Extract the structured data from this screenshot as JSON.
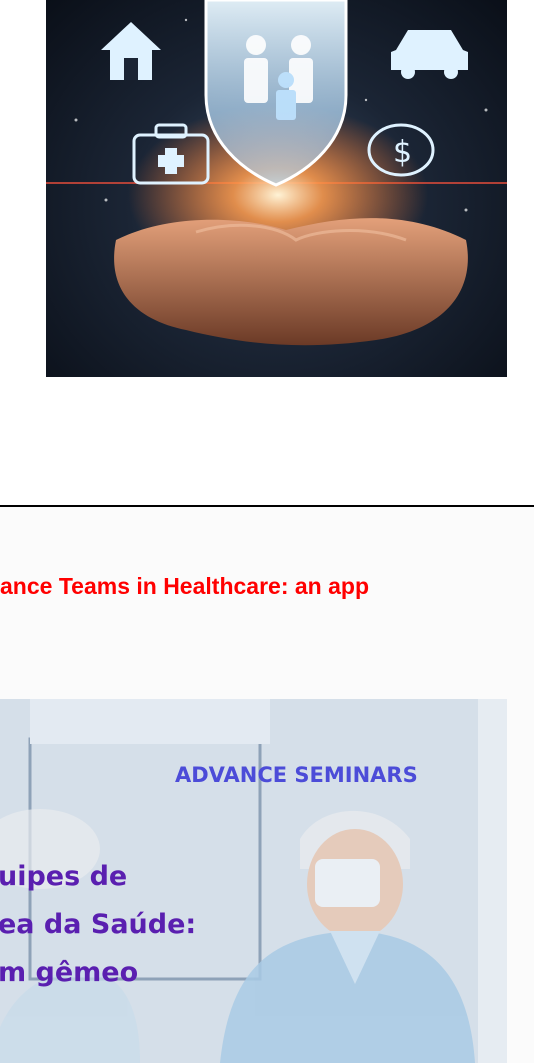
{
  "article": {
    "title": "ance Teams in Healthcare: an app"
  },
  "seminar": {
    "label": "ADVANCE SEMINARS",
    "lines": [
      "uipes de",
      "ea da Saúde:",
      "m gêmeo"
    ]
  },
  "hero": {
    "icons": [
      "house-icon",
      "shield-icon",
      "family-icon",
      "car-icon",
      "medical-kit-icon",
      "piggy-bank-icon",
      "hands-icon"
    ],
    "colors": {
      "glow": "#ff8a3c",
      "icon": "#dff2ff",
      "background": "#141c28"
    }
  },
  "colors": {
    "title": "#ff0000",
    "seminar_label": "#4c4cd8",
    "seminar_text": "#5a1fb0"
  }
}
